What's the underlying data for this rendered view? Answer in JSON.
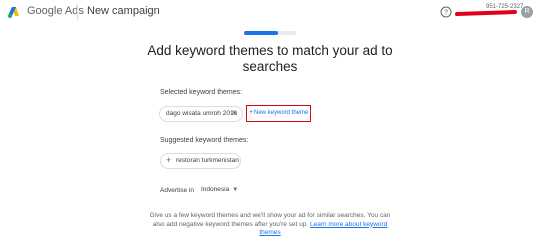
{
  "header": {
    "product_name": "Google Ads",
    "campaign_title": "New campaign",
    "account_id": "951-725-2327",
    "avatar_initial": "R",
    "logo_icon": "google-ads-logo",
    "help_icon": "help-circle-icon",
    "brand_colors": {
      "blue": "#1a73e8",
      "yellow": "#fbbc04",
      "green": "#34a853"
    }
  },
  "progress": {
    "fraction": 0.65,
    "color": "#1a73e8"
  },
  "main": {
    "heading": "Add keyword themes to match your ad to searches",
    "selected_label": "Selected keyword themes:",
    "selected_themes": [
      {
        "label": "dago wisata umroh 2016"
      }
    ],
    "new_theme_plus": "+",
    "new_theme_label": "New keyword theme",
    "suggested_label": "Suggested keyword themes:",
    "suggested_themes": [
      {
        "label": "restoran turkmenistan"
      }
    ],
    "advertise_label": "Advertise in",
    "language_value": "Indonesia",
    "help_text": "Give us a few keyword themes and we'll show your ad for similar searches. You can also add negative keyword themes after you're set up.",
    "help_link": "Learn more about keyword themes"
  },
  "annotation_color": "#e3001b"
}
